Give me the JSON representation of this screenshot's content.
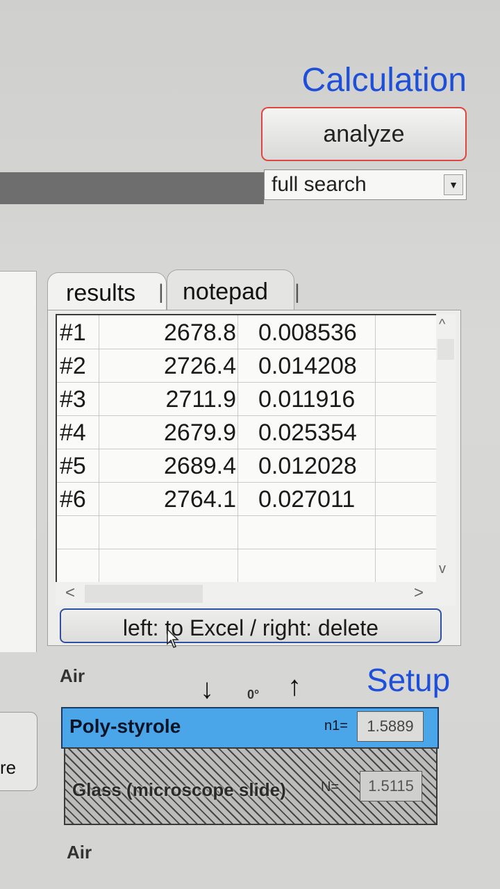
{
  "calculation": {
    "title": "Calculation",
    "analyze_label": "analyze",
    "search_mode": "full search"
  },
  "left_partial_button": {
    "label": "re"
  },
  "tabs": [
    {
      "label": "results",
      "active": true
    },
    {
      "label": "notepad",
      "active": false
    }
  ],
  "results": {
    "rows": [
      {
        "id": "#1",
        "a": "2678.8",
        "b": "0.008536"
      },
      {
        "id": "#2",
        "a": "2726.4",
        "b": "0.014208"
      },
      {
        "id": "#3",
        "a": "2711.9",
        "b": "0.011916"
      },
      {
        "id": "#4",
        "a": "2679.9",
        "b": "0.025354"
      },
      {
        "id": "#5",
        "a": "2689.4",
        "b": "0.012028"
      },
      {
        "id": "#6",
        "a": "2764.1",
        "b": "0.027011"
      }
    ],
    "excel_button_label": "left: to Excel / right: delete"
  },
  "setup": {
    "title": "Setup",
    "top_medium": "Air",
    "angle": "0°",
    "arrow_down": "↓",
    "arrow_up": "↑",
    "layers": [
      {
        "name": "Poly-styrole",
        "n_label": "n1=",
        "n_value": "1.5889",
        "color": "#4aa6e8"
      },
      {
        "name": "Glass (microscope slide)",
        "n_label": "N=",
        "n_value": "1.5115"
      }
    ],
    "bottom_medium": "Air"
  },
  "colors": {
    "accent": "#1e4fd8",
    "analyze_border": "#e0453d"
  }
}
